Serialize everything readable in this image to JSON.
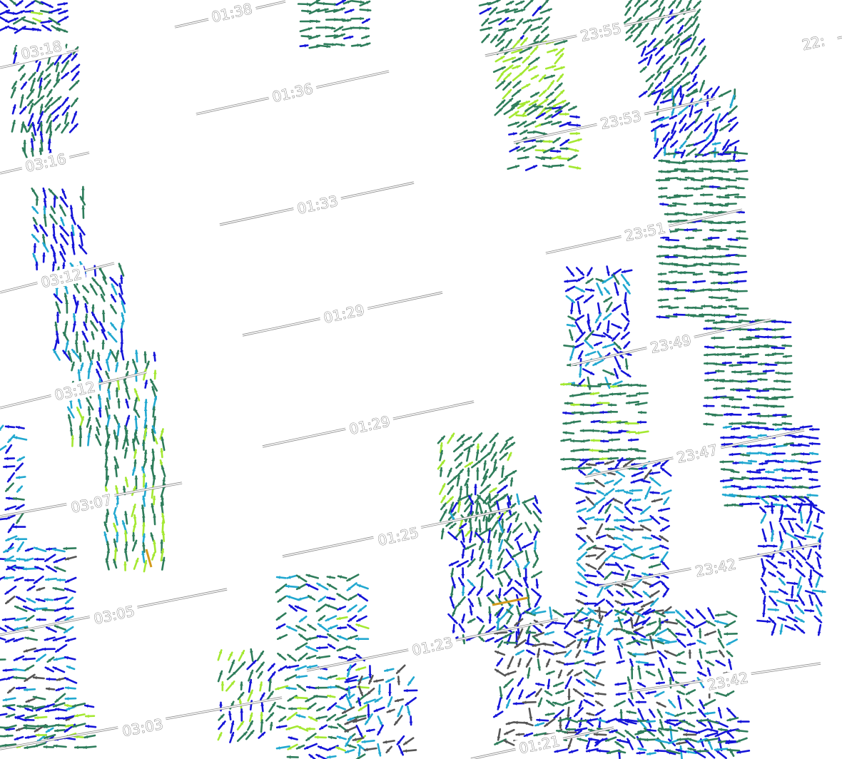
{
  "palette": {
    "dark_green": "#2e7d5b",
    "blue": "#1414d8",
    "cyan": "#21a8d0",
    "light_green": "#a4e831",
    "gray": "#555555",
    "orange": "#d39a1c"
  },
  "tracks": [
    {
      "id": "track-a",
      "labels": [
        "03:18",
        "03:16",
        "03:12",
        "03:12",
        "03:07",
        "03:05",
        "03:03"
      ]
    },
    {
      "id": "track-b",
      "labels": [
        "01:38",
        "01:36",
        "01:33",
        "01:29",
        "01:29",
        "01:25",
        "01:23",
        "01:21"
      ]
    },
    {
      "id": "track-c",
      "labels": [
        "23:55",
        "23:53",
        "23:51",
        "23:49",
        "23:47",
        "23:42",
        "23:42",
        "22:"
      ]
    }
  ]
}
